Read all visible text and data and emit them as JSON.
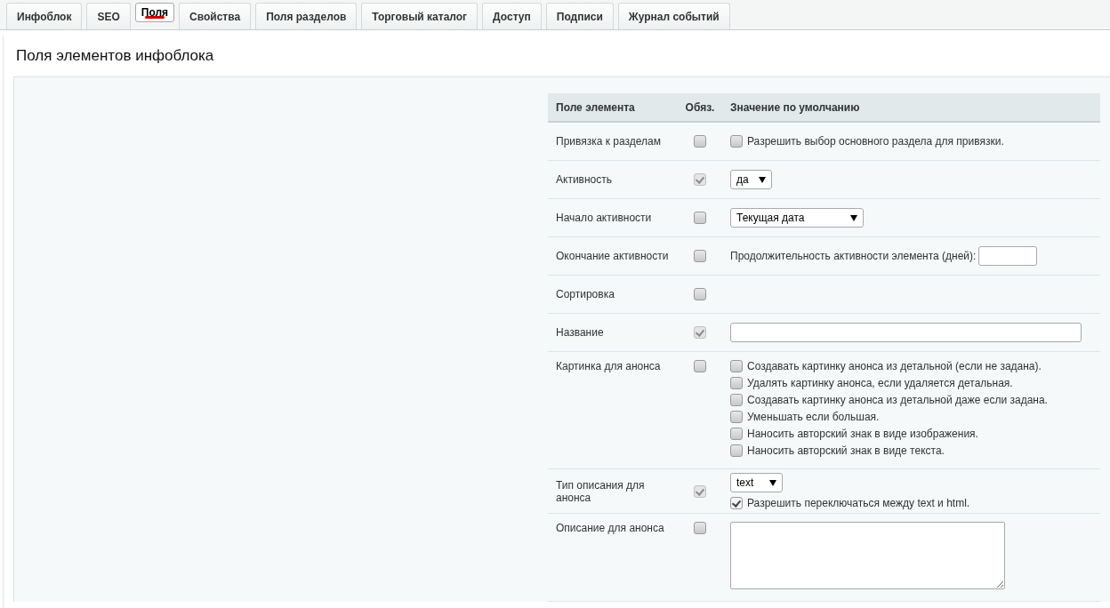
{
  "tabs": [
    {
      "label": "Инфоблок",
      "selected": false
    },
    {
      "label": "SEO",
      "selected": false
    },
    {
      "label": "Поля",
      "selected": true
    },
    {
      "label": "Свойства",
      "selected": false
    },
    {
      "label": "Поля разделов",
      "selected": false
    },
    {
      "label": "Торговый каталог",
      "selected": false
    },
    {
      "label": "Доступ",
      "selected": false
    },
    {
      "label": "Подписи",
      "selected": false
    },
    {
      "label": "Журнал событий",
      "selected": false
    }
  ],
  "section_title": "Поля элементов инфоблока",
  "table": {
    "columns": [
      "Поле элемента",
      "Обяз.",
      "Значение по умолчанию"
    ],
    "rows": [
      {
        "field": "Привязка к разделам",
        "required": {
          "checked": false,
          "disabled": false
        },
        "value": {
          "kind": "checks",
          "options": [
            {
              "label": "Разрешить выбор основного раздела для привязки.",
              "checked": false
            }
          ]
        }
      },
      {
        "field": "Активность",
        "required": {
          "checked": true,
          "disabled": true
        },
        "value": {
          "kind": "select",
          "value": "да"
        }
      },
      {
        "field": "Начало активности",
        "required": {
          "checked": false,
          "disabled": false
        },
        "value": {
          "kind": "select",
          "value": "Текущая дата"
        }
      },
      {
        "field": "Окончание активности",
        "required": {
          "checked": false,
          "disabled": false
        },
        "value": {
          "kind": "number",
          "label": "Продолжительность активности элемента (дней):"
        }
      },
      {
        "field": "Сортировка",
        "required": {
          "checked": false,
          "disabled": false
        }
      },
      {
        "field": "Название",
        "required": {
          "checked": true,
          "disabled": true
        },
        "value": {
          "kind": "text"
        }
      },
      {
        "field": "Картинка для анонса",
        "required": {
          "checked": false,
          "disabled": false
        },
        "value": {
          "kind": "checks",
          "options": [
            {
              "label": "Создавать картинку анонса из детальной (если не задана).",
              "checked": false
            },
            {
              "label": "Удалять картинку анонса, если удаляется детальная.",
              "checked": false
            },
            {
              "label": "Создавать картинку анонса из детальной даже если задана.",
              "checked": false
            },
            {
              "label": "Уменьшать если большая.",
              "checked": false
            },
            {
              "label": "Наносить авторский знак в виде изображения.",
              "checked": false
            },
            {
              "label": "Наносить авторский знак в виде текста.",
              "checked": false
            }
          ]
        }
      },
      {
        "field": "Тип описания для анонса",
        "required": {
          "checked": true,
          "disabled": true
        },
        "value": {
          "kind": "select-check",
          "value": "text",
          "option": {
            "label": "Разрешить переключаться между text и html.",
            "checked": true
          }
        }
      },
      {
        "field": "Описание для анонса",
        "required": {
          "checked": false,
          "disabled": false
        },
        "value": {
          "kind": "textarea"
        }
      }
    ]
  }
}
